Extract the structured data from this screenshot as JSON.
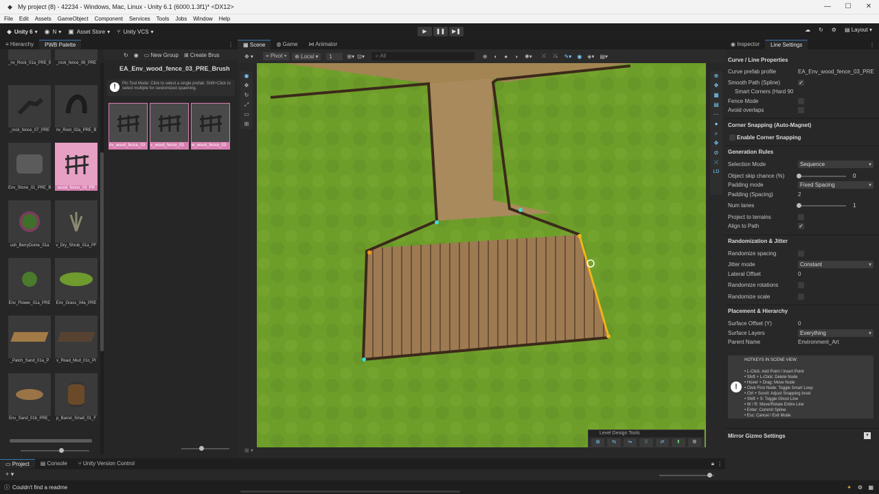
{
  "window": {
    "title": "My project (8) - 42234 - Windows, Mac, Linux - Unity 6.1 (6000.1.3f1)* <DX12>"
  },
  "menu": [
    "File",
    "Edit",
    "Assets",
    "GameObject",
    "Component",
    "Services",
    "Tools",
    "Jobs",
    "Window",
    "Help"
  ],
  "toolbar": {
    "unity_label": "Unity 6",
    "account_label": "N",
    "asset_store": "Asset Store",
    "vcs": "Unity VCS",
    "layout": "Layout"
  },
  "left": {
    "tabs": [
      "Hierarchy",
      "PWB Palette"
    ],
    "palette_buttons": [
      "New Group",
      "Create Brus"
    ],
    "palette_items": [
      {
        "label": "_nv_Rock_01a_PRE_B"
      },
      {
        "label": "_rock_fence_06_PRE"
      },
      {
        "label": "_rock_fence_07_PRE"
      },
      {
        "label": "nv_Root_02a_PRE_B"
      },
      {
        "label": "Env_Stone_01_PRE_B"
      },
      {
        "label": "wood_fence_03_PR",
        "selected": true
      },
      {
        "label": "ush_BerryDome_01a"
      },
      {
        "label": "v_Dry_Shrub_01a_PF"
      },
      {
        "label": "Env_Flower_01a_PRE"
      },
      {
        "label": "Env_Grass_04a_PRE"
      },
      {
        "label": "_Patch_Sand_01a_P"
      },
      {
        "label": "v_Road_Mud_01c_PI"
      },
      {
        "label": "Env_Sand_01b_PRE_"
      },
      {
        "label": "p_Barrel_Small_01_F"
      }
    ],
    "brush_name": "EA_Env_wood_fence_03_PRE_Brush",
    "brush_info": "Pin Tool Mode: Click to select a single prefab. Shift+Click to select multiple for randomized spawning.",
    "brush_items": [
      {
        "label": "nv_wood_fence_03"
      },
      {
        "label": "v_wood_fence_03"
      },
      {
        "label": "w_wood_fence_03"
      }
    ]
  },
  "scene": {
    "tabs": [
      "Scene",
      "Game",
      "Animator"
    ],
    "pivot": "Pivot",
    "local": "Local",
    "grid_value": "1",
    "search_placeholder": "All",
    "ldt_title": "Level Design Tools"
  },
  "inspector": {
    "tabs": [
      "Inspector",
      "Line Settings"
    ],
    "sections": {
      "curve": "Curve / Line Properties",
      "corner": "Corner Snapping (Auto-Magnet)",
      "gen": "Generation Rules",
      "rand": "Randomization & Jitter",
      "place": "Placement & Hierarchy",
      "mirror": "Mirror Gizmo Settings"
    },
    "curve_prefab_label": "Curve prefab profile",
    "curve_prefab_value": "EA_Env_wood_fence_03_PRE",
    "smooth_path": "Smooth Path (Spline)",
    "smart_corners": "Smart Corners (Hard 90",
    "fence_mode": "Fence Mode",
    "avoid_overlaps": "Avoid overlaps",
    "enable_corner": "Enable Corner Snapping",
    "selection_mode": "Selection Mode",
    "selection_mode_val": "Sequence",
    "skip_chance": "Object skip chance (%)",
    "skip_chance_val": "0",
    "padding_mode": "Padding mode",
    "padding_mode_val": "Fixed Spacing",
    "padding_spacing": "Padding (Spacing)",
    "padding_spacing_val": "2",
    "num_lanes": "Num lanes",
    "num_lanes_val": "1",
    "project_terrains": "Project to terrains",
    "align_path": "Align to Path",
    "randomize_spacing": "Randomize spacing",
    "jitter_mode": "Jitter mode",
    "jitter_mode_val": "Constant",
    "lateral_offset": "Lateral Offset",
    "lateral_offset_val": "0",
    "randomize_rotations": "Randomize rotations",
    "randomize_scale": "Randomize scale",
    "surface_offset": "Surface Offset (Y)",
    "surface_offset_val": "0",
    "surface_layers": "Surface Layers",
    "surface_layers_val": "Everything",
    "parent_name": "Parent Name",
    "parent_name_val": "Environment_Art",
    "hotkeys_title": "HOTKEYS IN SCENE VIEW:",
    "hotkeys": [
      "• L-Click: Add Point / Insert Point",
      "• Shift + L-Click: Delete Node",
      "• Hover + Drag: Move Node",
      "• Click First Node: Toggle Smart Loop",
      "• Ctrl + Scroll: Adjust Snapping Inset",
      "• Shift + S: Toggle Ghost Line",
      "• W / R: Move/Rotate Entire Line",
      "• Enter: Commit Spline",
      "• Esc: Cancel / Exit Mode"
    ]
  },
  "bottom": {
    "tabs": [
      "Project",
      "Console",
      "Unity Version Control"
    ]
  },
  "status": {
    "message": "Couldn't find a readme"
  }
}
